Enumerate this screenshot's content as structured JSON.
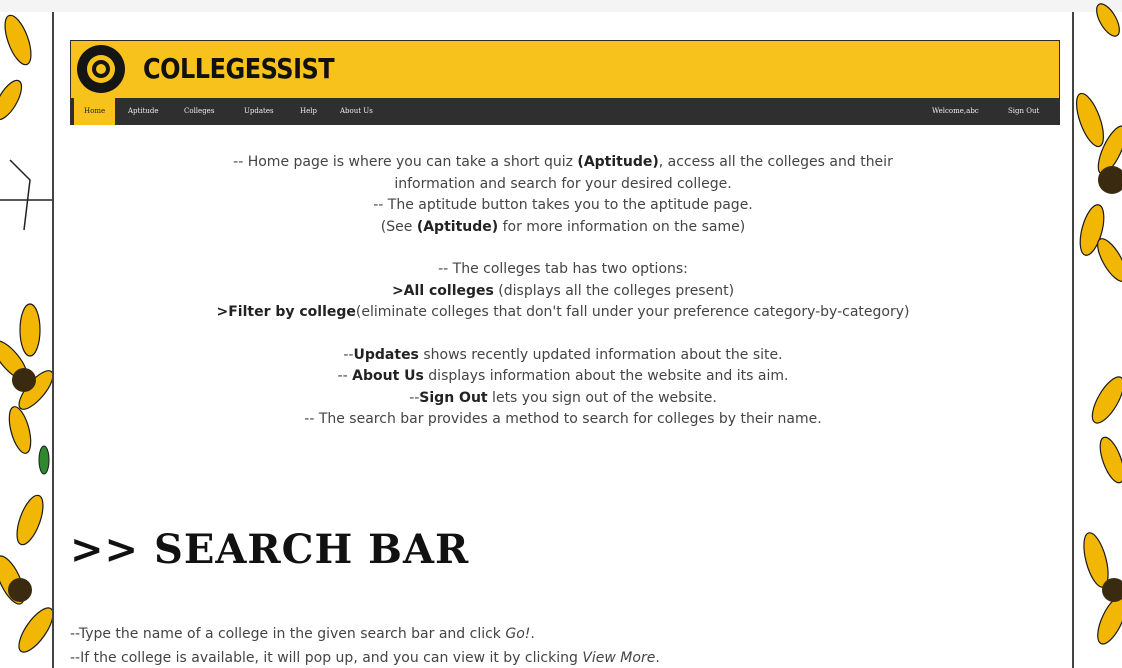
{
  "header": {
    "brand": "COLLEGESSIST"
  },
  "nav": {
    "home": "Home",
    "aptitude": "Aptitude",
    "colleges": "Colleges",
    "updates": "Updates",
    "help": "Help",
    "about": "About Us",
    "welcome": "Welcome,abc",
    "signout": "Sign Out"
  },
  "intro": {
    "l1a": "-- Home page is where you can take a short quiz ",
    "l1b": "(Aptitude)",
    "l1c": ", access all the colleges and their",
    "l2": "information and search for your desired college.",
    "l3": "-- The aptitude button takes you to the aptitude page.",
    "l4a": "(See ",
    "l4b": "(Aptitude)",
    "l4c": " for more information on the same)",
    "l5": "-- The colleges tab has two options:",
    "l6a": ">All colleges",
    "l6b": " (displays all the colleges present)",
    "l7a": ">Filter by college",
    "l7b": "(eliminate colleges that don't fall under your preference category-by-category)",
    "l8a": "--",
    "l8b": "Updates",
    "l8c": " shows recently updated information about the site.",
    "l9a": "-- ",
    "l9b": "About Us",
    "l9c": " displays information about the website and its aim.",
    "l10a": "--",
    "l10b": "Sign Out",
    "l10c": " lets you sign out of the website.",
    "l11": "-- The search bar provides a method to search for colleges by their name."
  },
  "search_section": {
    "title": ">> SEARCH BAR",
    "line1a": "--Type the name of a college in the given search bar and click ",
    "line1b": "Go!",
    "line1c": ".",
    "line2a": "--If the college is available, it will pop up, and you can view it by clicking ",
    "line2b": "View More",
    "line2c": "."
  },
  "colors": {
    "accent": "#f7c21b",
    "nav_bg": "#2f2f2f"
  }
}
